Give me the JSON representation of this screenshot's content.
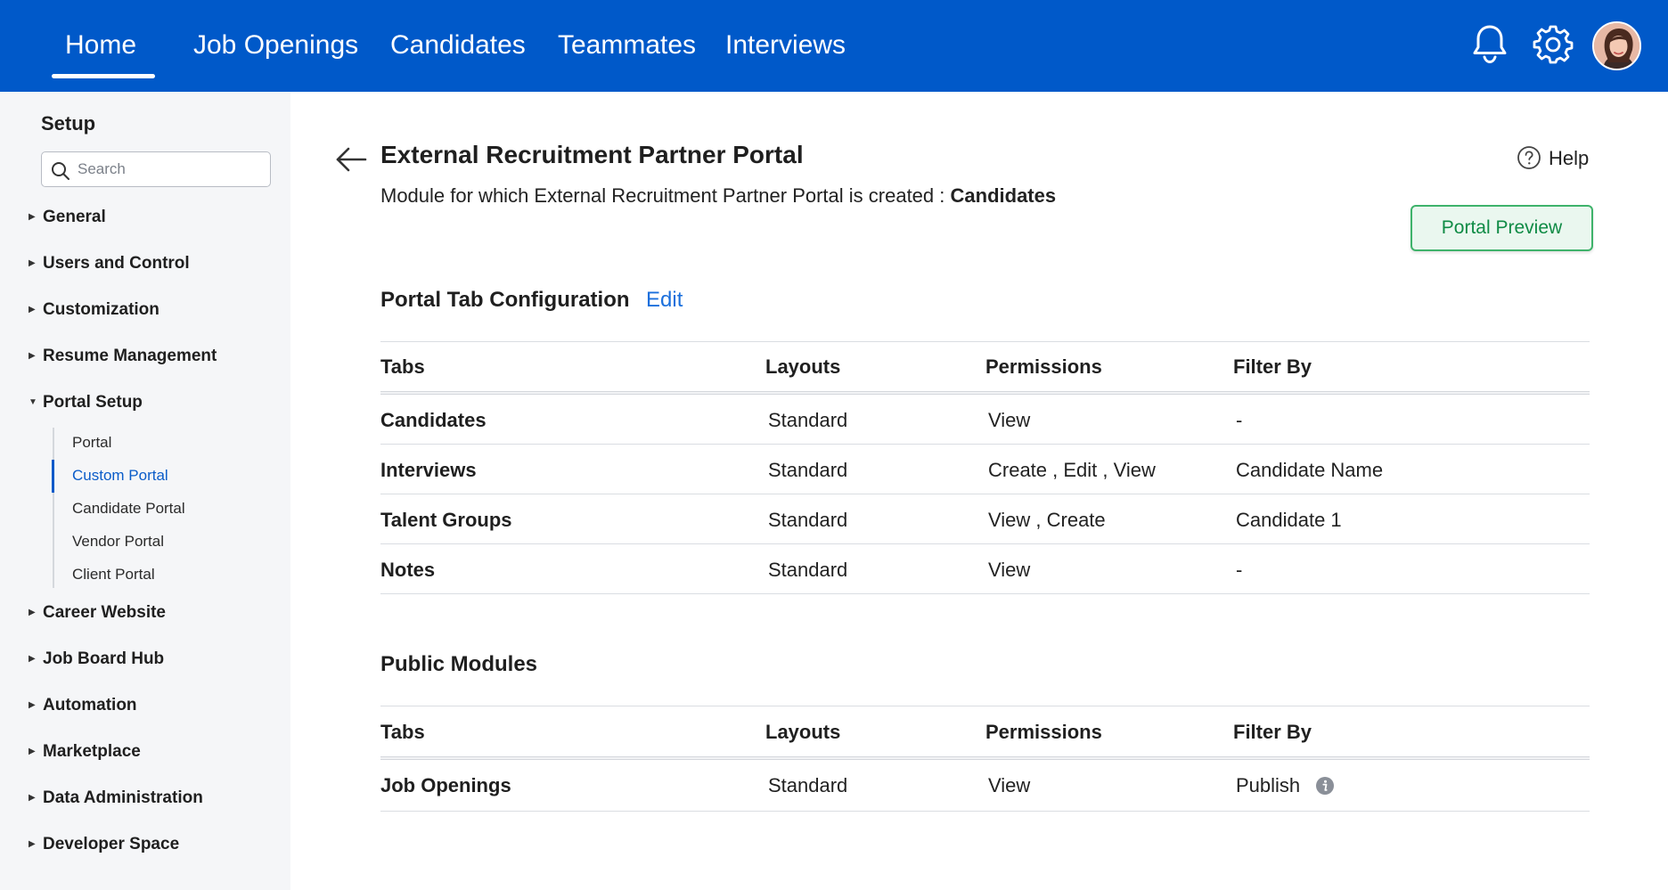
{
  "nav": {
    "tabs": [
      "Home",
      "Job Openings",
      "Candidates",
      "Teammates",
      "Interviews"
    ],
    "active": "Home",
    "icons": [
      "bell-icon",
      "gear-icon"
    ],
    "brand_color": "#0059c9"
  },
  "sidebar": {
    "title": "Setup",
    "search_placeholder": "Search",
    "items_top": [
      "General",
      "Users and Control",
      "Customization",
      "Resume Management"
    ],
    "expanded": "Portal Setup",
    "sub_items": [
      "Portal",
      "Custom Portal",
      "Candidate Portal",
      "Vendor Portal",
      "Client Portal"
    ],
    "active_sub": "Custom Portal",
    "items_bottom": [
      "Career Website",
      "Job Board Hub",
      "Automation",
      "Marketplace",
      "Data Administration",
      "Developer Space"
    ]
  },
  "page": {
    "title": "External Recruitment Partner Portal",
    "module_prefix": "Module for which External Recruitment Partner Portal is created :",
    "module_name": "Candidates",
    "help_label": "Help",
    "preview_button": "Portal Preview"
  },
  "tab_config": {
    "title": "Portal Tab Configuration",
    "edit_label": "Edit",
    "headers": [
      "Tabs",
      "Layouts",
      "Permissions",
      "Filter By"
    ],
    "rows": [
      [
        "Candidates",
        "Standard",
        "View",
        "-"
      ],
      [
        "Interviews",
        "Standard",
        "Create , Edit , View",
        "Candidate Name"
      ],
      [
        "Talent Groups",
        "Standard",
        "View , Create",
        "Candidate 1"
      ],
      [
        "Notes",
        "Standard",
        "View",
        "-"
      ]
    ]
  },
  "public_modules": {
    "title": "Public Modules",
    "headers": [
      "Tabs",
      "Layouts",
      "Permissions",
      "Filter By"
    ],
    "rows": [
      [
        "Job Openings",
        "Standard",
        "View",
        "Publish"
      ]
    ],
    "filter_icon": "info-icon"
  }
}
